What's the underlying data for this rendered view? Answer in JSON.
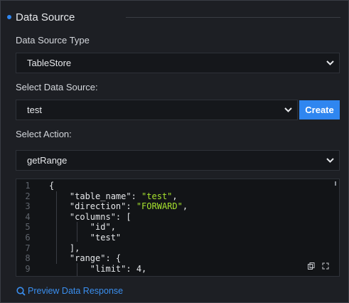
{
  "section": {
    "title": "Data Source"
  },
  "source_type": {
    "label": "Data Source Type",
    "value": "TableStore",
    "icon": "chevron-down-icon"
  },
  "select_source": {
    "label": "Select Data Source:",
    "value": "test",
    "icon": "chevron-down-icon",
    "create_label": "Create"
  },
  "select_action": {
    "label": "Select Action:",
    "value": "getRange",
    "icon": "chevron-down-icon"
  },
  "editor": {
    "line_numbers": [
      "1",
      "2",
      "3",
      "4",
      "5",
      "6",
      "7",
      "8",
      "9"
    ],
    "lines": [
      "{",
      "    \"table_name\": \"test\",",
      "    \"direction\": \"FORWARD\",",
      "    \"columns\": [",
      "        \"id\",",
      "        \"test\"",
      "    ],",
      "    \"range\": {",
      "        \"limit\": 4,"
    ],
    "tools": [
      "copy-icon",
      "fullscreen-icon"
    ]
  },
  "preview": {
    "label": "Preview Data Response",
    "icon": "search-icon"
  },
  "colors": {
    "accent": "#2f86f0",
    "link": "#3a8ff0",
    "string": "#a6e22e",
    "background": "#1d1f24",
    "field": "#15171b"
  }
}
